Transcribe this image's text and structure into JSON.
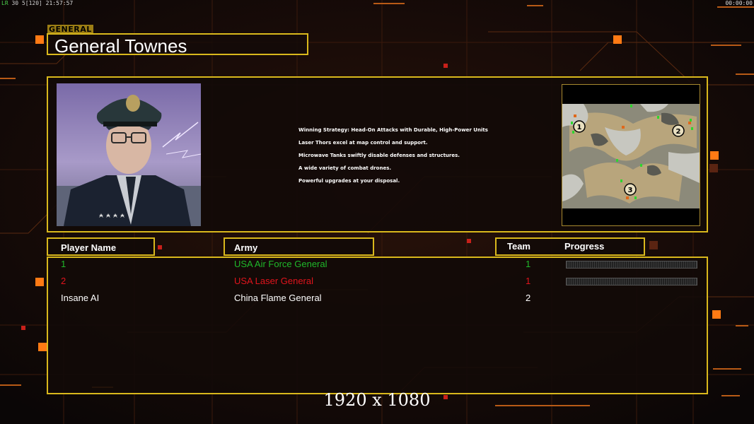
{
  "hud": {
    "fps_label": "LR",
    "fps_value": "30",
    "frame_info": "5[120]",
    "clock": "21:57:57",
    "timer": "00:00:00"
  },
  "header": {
    "tag": "GENERAL",
    "title": "General Townes"
  },
  "info": {
    "bullets": [
      "Winning Strategy: Head-On Attacks with Durable, High-Power Units",
      "Laser Thors excel at map control and support.",
      "Microwave Tanks swiftly disable defenses and structures.",
      "A wide variety of combat drones.",
      "Powerful upgrades at your disposal."
    ],
    "map_markers": [
      "1",
      "2",
      "3"
    ]
  },
  "columns": {
    "player": "Player Name",
    "army": "Army",
    "team": "Team",
    "progress": "Progress"
  },
  "players": [
    {
      "name": "1",
      "army": "USA Air Force General",
      "team": "1",
      "color": "#1fb82a",
      "progress": 0
    },
    {
      "name": "2",
      "army": "USA Laser General",
      "team": "1",
      "color": "#e0141c",
      "progress": 0
    },
    {
      "name": "Insane AI",
      "army": "China Flame General",
      "team": "2",
      "color": "#ffffff"
    }
  ],
  "footer": {
    "resolution": "1920 x 1080"
  },
  "colors": {
    "frame": "#d9b81c",
    "accent_orange": "#ff8a1a",
    "background": "#0d0808"
  }
}
